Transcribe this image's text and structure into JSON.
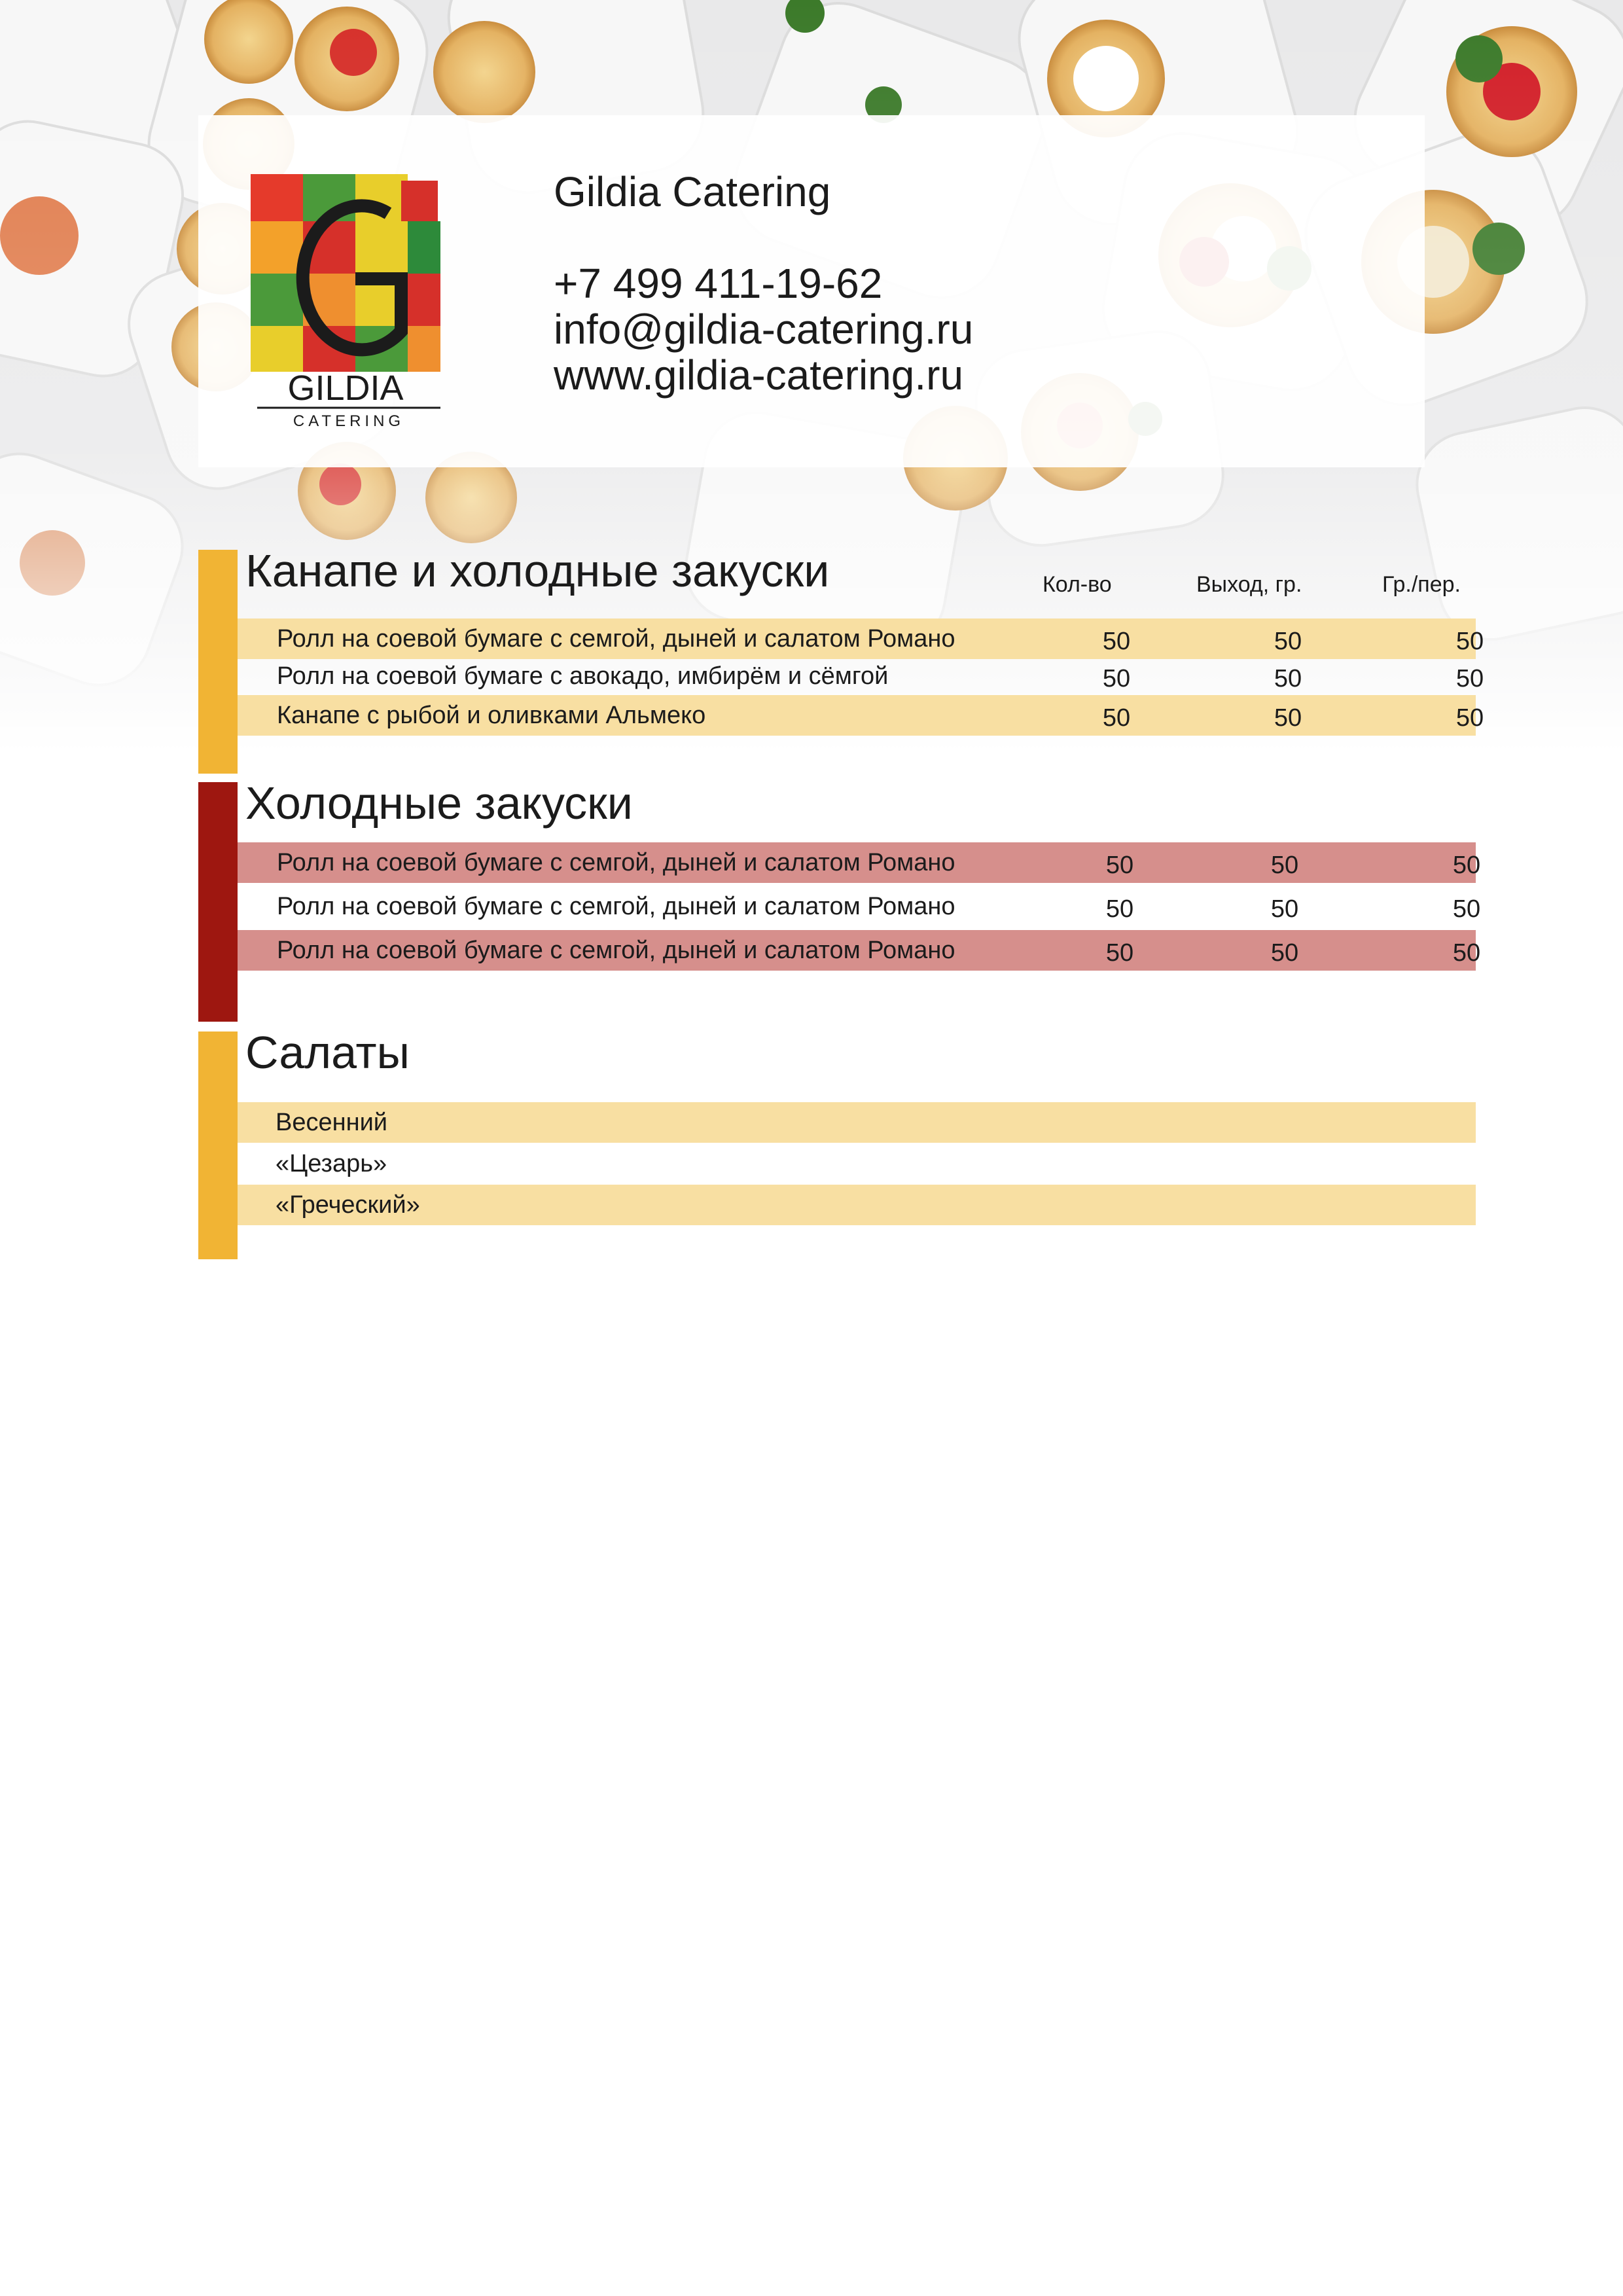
{
  "colors": {
    "bar_yellow": "#f1b434",
    "bar_red": "#9e1710",
    "row_yellow": "#f8dfa2",
    "row_pink": "#d68f8c"
  },
  "header": {
    "company_name": "Gildia Catering",
    "phone": "+7 499 411-19-62",
    "email": "info@gildia-catering.ru",
    "website": "www.gildia-catering.ru",
    "logo": {
      "letter": "G",
      "wordmark": "GILDIA",
      "tagline": "CATERING"
    }
  },
  "columns": [
    "Кол-во",
    "Выход, гр.",
    "Гр./пер."
  ],
  "sections": [
    {
      "title": "Канапе и холодные закуски",
      "rows": [
        {
          "name": "Ролл на соевой бумаге с семгой, дыней и салатом Романо",
          "qty": "50",
          "yield": "50",
          "per": "50"
        },
        {
          "name": "Ролл на соевой бумаге с авокадо, имбирём и сёмгой",
          "qty": "50",
          "yield": "50",
          "per": "50"
        },
        {
          "name": "Канапе с рыбой и оливками Альмеко",
          "qty": "50",
          "yield": "50",
          "per": "50"
        }
      ]
    },
    {
      "title": "Холодные закуски",
      "rows": [
        {
          "name": "Ролл на соевой бумаге с семгой, дыней и салатом Романо",
          "qty": "50",
          "yield": "50",
          "per": "50"
        },
        {
          "name": "Ролл на соевой бумаге с семгой, дыней и салатом Романо",
          "qty": "50",
          "yield": "50",
          "per": "50"
        },
        {
          "name": "Ролл на соевой бумаге с семгой, дыней и салатом Романо",
          "qty": "50",
          "yield": "50",
          "per": "50"
        }
      ]
    },
    {
      "title": "Салаты",
      "rows": [
        {
          "name": "Весенний"
        },
        {
          "name": "«Цезарь»"
        },
        {
          "name": "«Греческий»"
        }
      ]
    }
  ]
}
